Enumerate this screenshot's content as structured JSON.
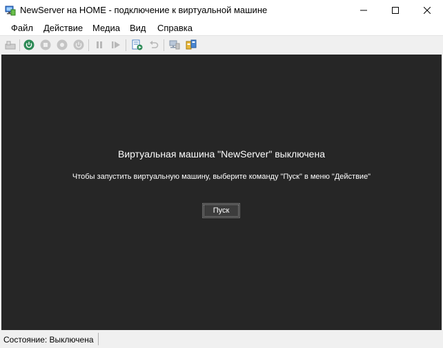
{
  "window": {
    "title": "NewServer на HOME - подключение к виртуальной машине"
  },
  "menu": {
    "items": [
      "Файл",
      "Действие",
      "Медиа",
      "Вид",
      "Справка"
    ]
  },
  "toolbar": {
    "buttons": [
      "ctrl-alt-del-icon",
      "start-icon",
      "turn-off-icon",
      "shut-down-icon",
      "power-icon",
      "pause-icon",
      "reset-icon",
      "checkpoint-icon",
      "revert-icon",
      "enhanced-session-icon",
      "share-icon"
    ]
  },
  "vm": {
    "heading": "Виртуальная машина \"NewServer\" выключена",
    "description": "Чтобы запустить виртуальную машину, выберите команду \"Пуск\" в меню \"Действие\"",
    "start_label": "Пуск",
    "background": "#262626"
  },
  "status": {
    "text": "Состояние: Выключена"
  },
  "colors": {
    "accent_green": "#2e8b57",
    "screen": "#262626"
  }
}
